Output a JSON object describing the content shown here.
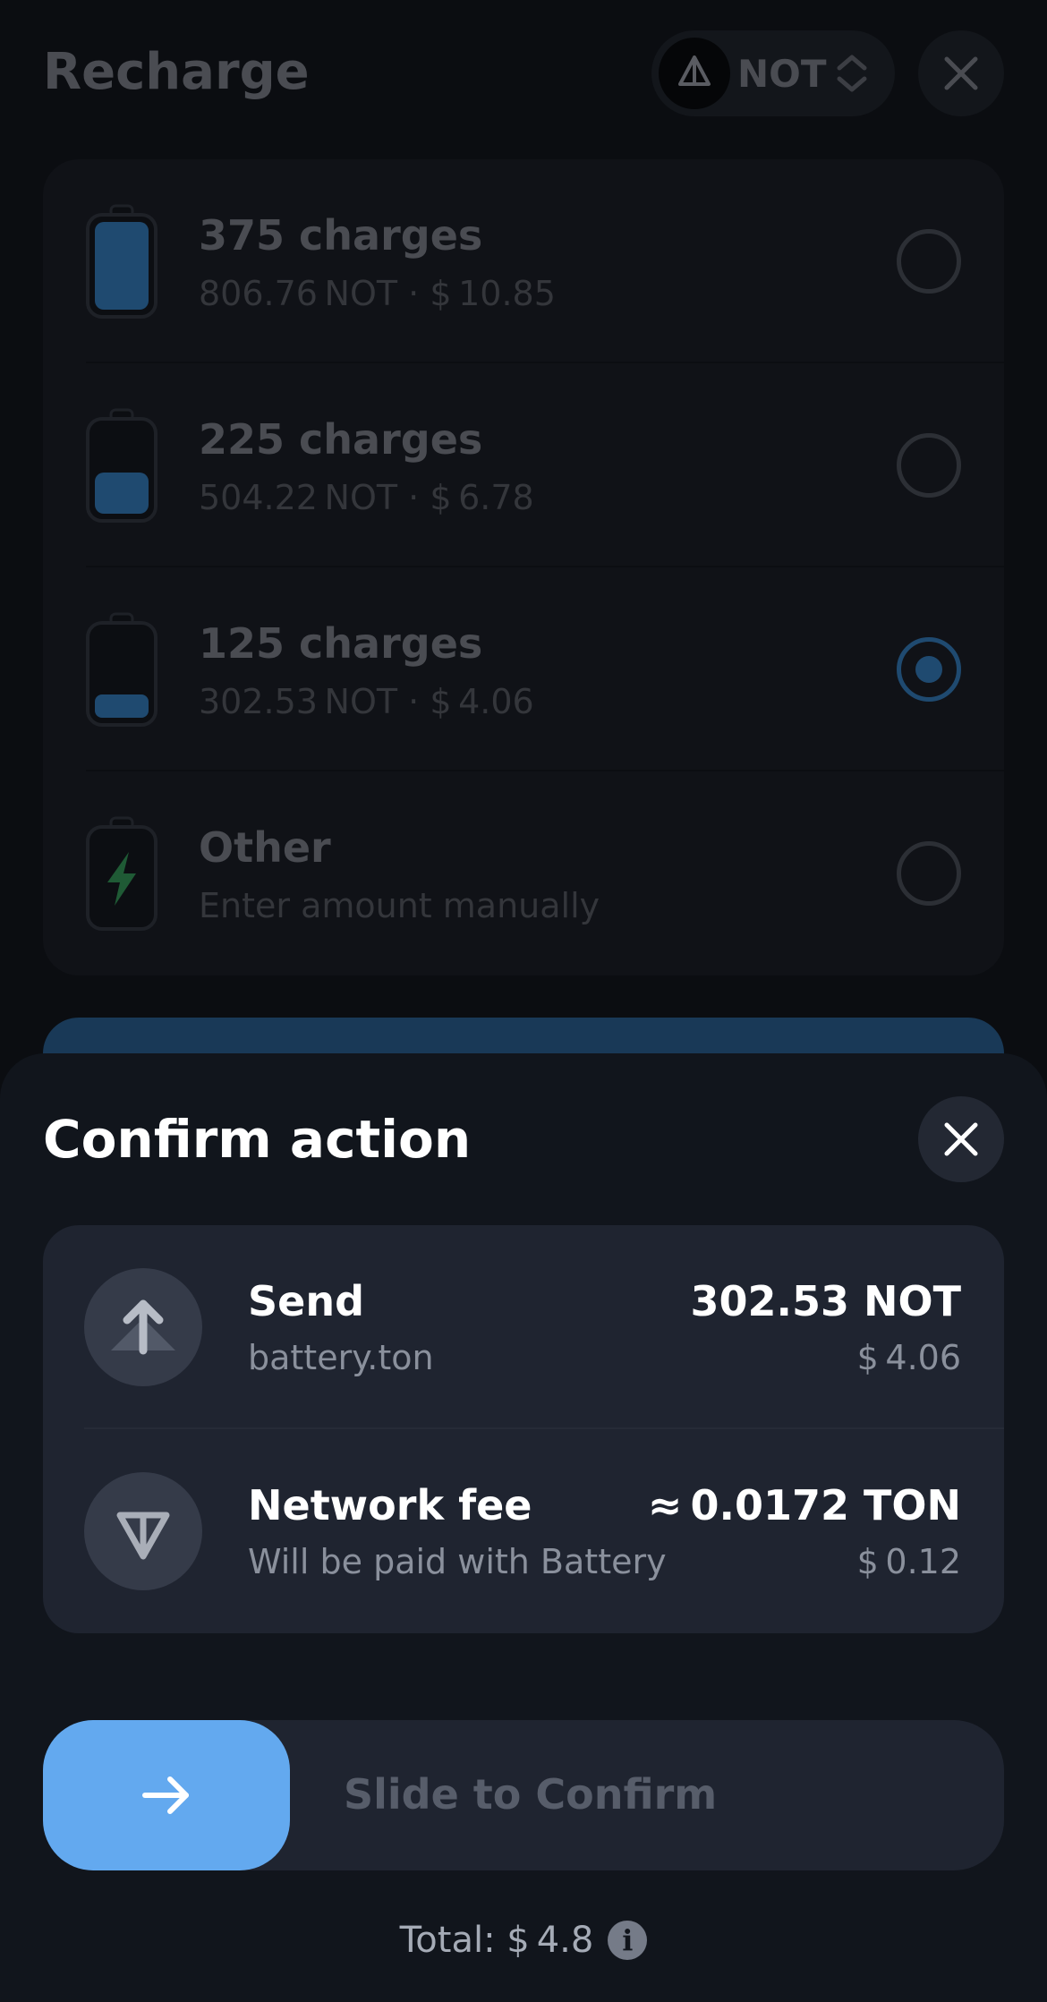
{
  "background": {
    "title": "Recharge",
    "token_selector": {
      "label": "NOT",
      "icon": "not-coin-icon"
    },
    "options": [
      {
        "title": "375 charges",
        "subtitle": "806.76 NOT · $ 10.85",
        "selected": false,
        "level": 1.0
      },
      {
        "title": "225 charges",
        "subtitle": "504.22 NOT · $ 6.78",
        "selected": false,
        "level": 0.45
      },
      {
        "title": "125 charges",
        "subtitle": "302.53 NOT · $ 4.06",
        "selected": true,
        "level": 0.25
      },
      {
        "title": "Other",
        "subtitle": "Enter amount manually",
        "selected": false,
        "level": null
      }
    ]
  },
  "sheet": {
    "title": "Confirm action",
    "rows": [
      {
        "icon": "arrow-up-icon",
        "title": "Send",
        "subtitle": "battery.ton",
        "amount": "302.53 NOT",
        "fiat": "$ 4.06"
      },
      {
        "icon": "ton-icon",
        "title": "Network fee",
        "subtitle": "Will be paid with Battery",
        "amount": "≈ 0.0172 TON",
        "fiat": "$ 0.12"
      }
    ],
    "slider_label": "Slide to Confirm",
    "total": "Total: $ 4.8"
  },
  "colors": {
    "accent": "#63a9ef",
    "sheet_bg": "#11151c",
    "card_bg": "#1f2430",
    "battery_fill": "#1f4a70",
    "bolt": "#1f5a35"
  }
}
